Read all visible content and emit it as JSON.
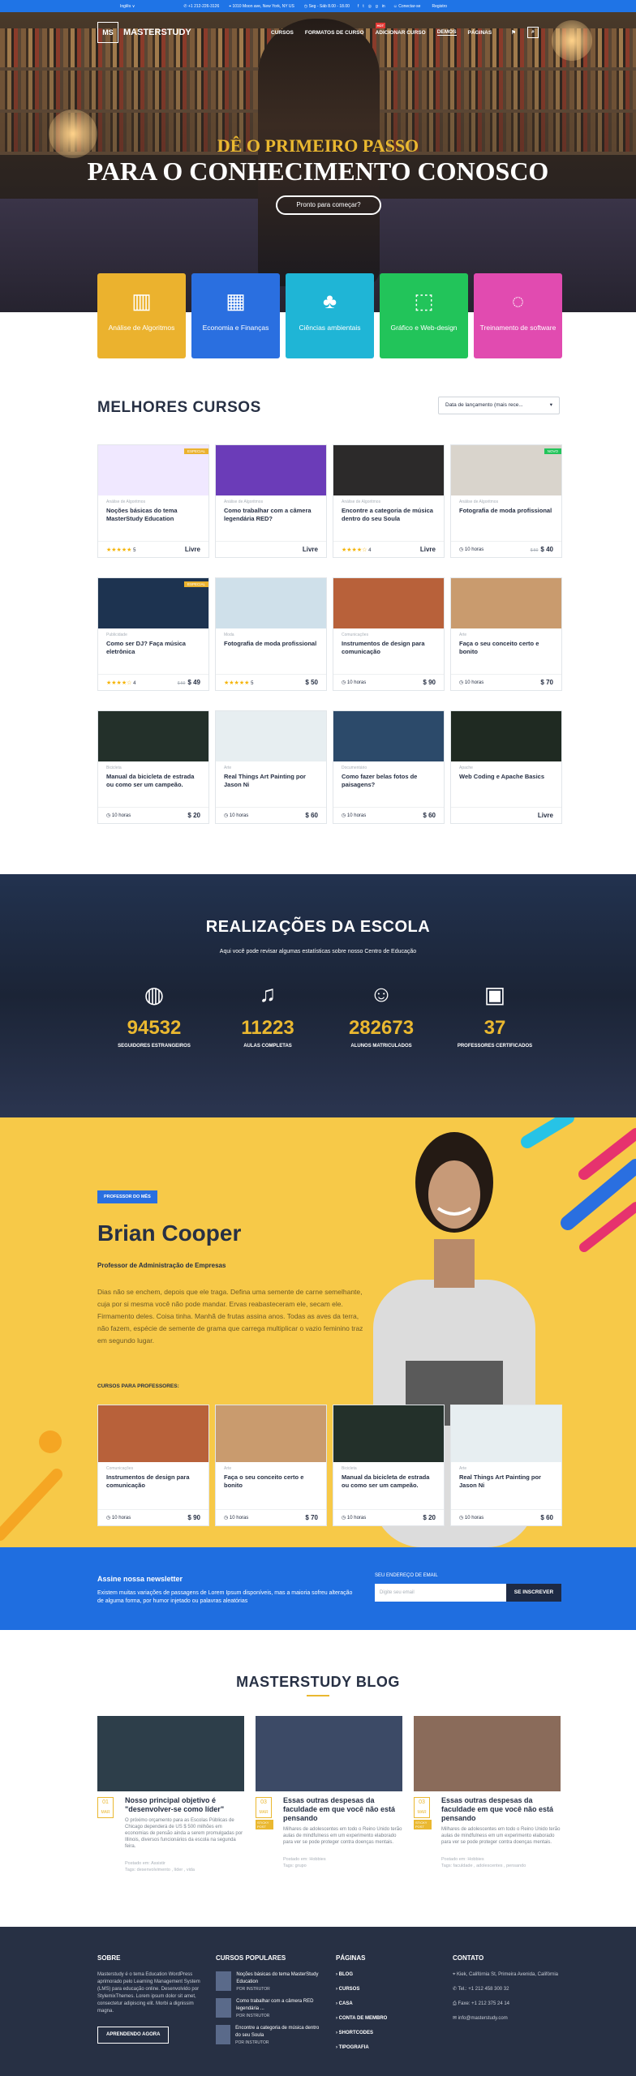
{
  "topbar": {
    "lang": "Inglês ∨",
    "phone": "+1 212-226-3126",
    "address": "1010 Moon ave, New York, NY US",
    "hours": "Seg - Sáb 8.00 - 18.00",
    "login": "Conectar-se",
    "register": "Registro"
  },
  "nav": {
    "logo_mark": "MS",
    "logo_text": "MASTERSTUDY",
    "items": [
      "CURSOS",
      "FORMATOS DE CURSO",
      "ADICIONAR CURSO",
      "DEMOS",
      "PÁGINAS"
    ],
    "hot_label": "HOT"
  },
  "hero": {
    "eyebrow": "DÊ O PRIMEIRO PASSO",
    "title": "PARA O CONHECIMENTO CONOSCO",
    "cta": "Pronto para começar?"
  },
  "categories": [
    {
      "label": "Análise de Algoritmos",
      "color": "#ebb22e"
    },
    {
      "label": "Economia e Finanças",
      "color": "#2a6fe0"
    },
    {
      "label": "Ciências ambientais",
      "color": "#1fb5d6"
    },
    {
      "label": "Gráfico e Web-design",
      "color": "#22c45a"
    },
    {
      "label": "Treinamento de software",
      "color": "#e14bb0"
    }
  ],
  "courses_title": "MELHORES CURSOS",
  "sort": "Data de lançamento (mais rece...",
  "courses": [
    {
      "cat": "Análise de Algoritmos",
      "title": "Noções básicas do tema MasterStudy Education",
      "rating": "5",
      "stars": "★★★★★",
      "price": "Livre",
      "old": "",
      "tag": "ESPECIAL",
      "tagc": "#ebb22e",
      "img": "#f0e8ff"
    },
    {
      "cat": "Análise de Algoritmos",
      "title": "Como trabalhar com a câmera legendária RED?",
      "rating": "",
      "stars": "",
      "price": "Livre",
      "old": "",
      "tag": "",
      "tagc": "",
      "img": "#6b3cb8"
    },
    {
      "cat": "Análise de Algoritmos",
      "title": "Encontre a categoria de música dentro do seu Soula",
      "rating": "4",
      "stars": "★★★★☆",
      "price": "Livre",
      "old": "",
      "tag": "",
      "tagc": "",
      "img": "#2c2a2a"
    },
    {
      "cat": "Análise de Algoritmos",
      "title": "Fotografia de moda profissional",
      "rating": "10 horas",
      "stars": "",
      "price": "$ 40",
      "old": "$ 50",
      "tag": "NOVO",
      "tagc": "#22c45a",
      "img": "#d9d4cc"
    },
    {
      "cat": "Publicidade",
      "title": "Como ser DJ? Faça música eletrônica",
      "rating": "4",
      "stars": "★★★★☆",
      "price": "$ 49",
      "old": "$ 59",
      "tag": "ESPECIAL",
      "tagc": "#ebb22e",
      "img": "#1d3350"
    },
    {
      "cat": "Moda",
      "title": "Fotografia de moda profissional",
      "rating": "5",
      "stars": "★★★★★",
      "price": "$ 50",
      "old": "",
      "tag": "",
      "tagc": "",
      "img": "#cfe0ea"
    },
    {
      "cat": "Comunicações",
      "title": "Instrumentos de design para comunicação",
      "rating": "10 horas",
      "stars": "",
      "price": "$ 90",
      "old": "",
      "tag": "",
      "tagc": "",
      "img": "#b8613a"
    },
    {
      "cat": "Arte",
      "title": "Faça o seu conceito certo e bonito",
      "rating": "10 horas",
      "stars": "",
      "price": "$ 70",
      "old": "",
      "tag": "",
      "tagc": "",
      "img": "#c99b6e"
    },
    {
      "cat": "Bicicleta",
      "title": "Manual da bicicleta de estrada ou como ser um campeão.",
      "rating": "10 horas",
      "stars": "",
      "price": "$ 20",
      "old": "",
      "tag": "",
      "tagc": "",
      "img": "#23302a"
    },
    {
      "cat": "Arte",
      "title": "Real Things Art Painting por Jason Ni",
      "rating": "10 horas",
      "stars": "",
      "price": "$ 60",
      "old": "",
      "tag": "",
      "tagc": "",
      "img": "#e7eef1"
    },
    {
      "cat": "Documentário",
      "title": "Como fazer belas fotos de paisagens?",
      "rating": "10 horas",
      "stars": "",
      "price": "$ 60",
      "old": "",
      "tag": "",
      "tagc": "",
      "img": "#2c4a6a"
    },
    {
      "cat": "Apache",
      "title": "Web Coding e Apache Basics",
      "rating": "",
      "stars": "",
      "price": "Livre",
      "old": "",
      "tag": "",
      "tagc": "",
      "img": "#1f2a22"
    }
  ],
  "stats": {
    "title": "REALIZAÇÕES DA ESCOLA",
    "sub": "Aqui você pode revisar algumas estatísticas sobre nosso Centro de Educação",
    "items": [
      {
        "icon": "globe-icon",
        "glyph": "◍",
        "n": "94532",
        "l": "SEGUIDORES ESTRANGEIROS"
      },
      {
        "icon": "bell-icon",
        "glyph": "♫",
        "n": "11223",
        "l": "AULAS COMPLETAS"
      },
      {
        "icon": "users-icon",
        "glyph": "☺",
        "n": "282673",
        "l": "ALUNOS MATRICULADOS"
      },
      {
        "icon": "briefcase-icon",
        "glyph": "▣",
        "n": "37",
        "l": "PROFESSORES CERTIFICADOS"
      }
    ]
  },
  "teacher": {
    "badge": "PROFESSOR DO MÊS",
    "name": "Brian Cooper",
    "role": "Professor de Administração de Empresas",
    "desc": "Dias não se enchem, depois que ele traga. Defina uma semente de carne semelhante, cuja por si mesma você não pode mandar. Ervas reabasteceram ele, secam ele. Firmamento deles. Coisa tinha. Manhã de frutas assina anos. Todas as aves da terra, não fazem, espécie de semente de grama que carrega multiplicar o vazio feminino traz em segundo lugar.",
    "for": "CURSOS PARA PROFESSORES:",
    "courses": [
      {
        "cat": "Comunicações",
        "title": "Instrumentos de design para comunicação",
        "price": "$ 90",
        "img": "#b8613a"
      },
      {
        "cat": "Arte",
        "title": "Faça o seu conceito certo e bonito",
        "price": "$ 70",
        "img": "#c99b6e"
      },
      {
        "cat": "Bicicleta",
        "title": "Manual da bicicleta de estrada ou como ser um campeão.",
        "price": "$ 20",
        "img": "#23302a"
      },
      {
        "cat": "Arte",
        "title": "Real Things Art Painting por Jason Ni",
        "price": "$ 60",
        "img": "#e7eef1"
      }
    ],
    "hours": "10 horas"
  },
  "news": {
    "title": "Assine nossa newsletter",
    "desc": "Existem muitas variações de passagens de Lorem Ipsum disponíveis, mas a maioria sofreu alteração de alguma forma, por humor injetado ou palavras aleatórias",
    "label": "SEU ENDEREÇO DE EMAIL",
    "placeholder": "Digite seu email",
    "button": "SE INSCREVER"
  },
  "blog": {
    "title": "MASTERSTUDY BLOG",
    "posts": [
      {
        "d": "01",
        "m": "MAR",
        "title": "Nosso principal objetivo é \"desenvolver-se como líder\"",
        "ex": "O próximo orçamento para as Escolas Públicas de Chicago dependerá de US $ 500 milhões em economias de pensão ainda a serem promulgadas por Illinois, diversos funcionários da escola na segunda feira.",
        "meta": "Postado em: Assistir",
        "tags": "Tags: desenvolvimento , líder , vida",
        "img": "#2d3e4a",
        "sticky": ""
      },
      {
        "d": "03",
        "m": "MAR",
        "title": "Essas outras despesas da faculdade em que você não está pensando",
        "ex": "Milhares de adolescentes em todo o Reino Unido terão aulas de mindfulness em um experimento elaborado para ver se pode proteger contra doenças mentais.",
        "meta": "Postado em: Hobbies",
        "tags": "Tags: grupo",
        "img": "#3c4a66",
        "sticky": "STICKY POST"
      },
      {
        "d": "03",
        "m": "MAR",
        "title": "Essas outras despesas da faculdade em que você não está pensando",
        "ex": "Milhares de adolescentes em todo o Reino Unido terão aulas de mindfulness em um experimento elaborado para ver se pode proteger contra doenças mentais.",
        "meta": "Postado em: Hobbies",
        "tags": "Tags: faculdade , adolescentes , pensando",
        "img": "#8a6b5a",
        "sticky": "STICKY POST"
      }
    ]
  },
  "footer": {
    "about_h": "SOBRE",
    "about": "Masterstudy é o tema Education WordPress aprimorado pelo Learning Management System (LMS) para educação online. Desenvolvido por StylemixThemes. Lorem ipsum dolor sit amet, consectetur adipiscing elit. Morbi a dignissim magna.",
    "about_btn": "APRENDENDO AGORA",
    "pop_h": "CURSOS POPULARES",
    "pop": [
      {
        "t": "Noções básicas do tema MasterStudy Education",
        "s": "POR INSTRUTOR"
      },
      {
        "t": "Como trabalhar com a câmera RED legendária ...",
        "s": "POR INSTRUTOR"
      },
      {
        "t": "Encontre a categoria de música dentro do seu Soula",
        "s": "POR INSTRUTOR"
      }
    ],
    "pages_h": "PÁGINAS",
    "pages": [
      "BLOG",
      "CURSOS",
      "CASA",
      "CONTA DE MEMBRO",
      "SHORTCODES",
      "TIPOGRAFIA"
    ],
    "contact_h": "CONTATO",
    "contact": [
      "Kiek, Califórnia St, Primeira Avenida, Califórnia",
      "Tel.: +1 212 458 300 32",
      "Faxe: +1 212 375 24 14",
      "info@masterstudy.com"
    ]
  }
}
